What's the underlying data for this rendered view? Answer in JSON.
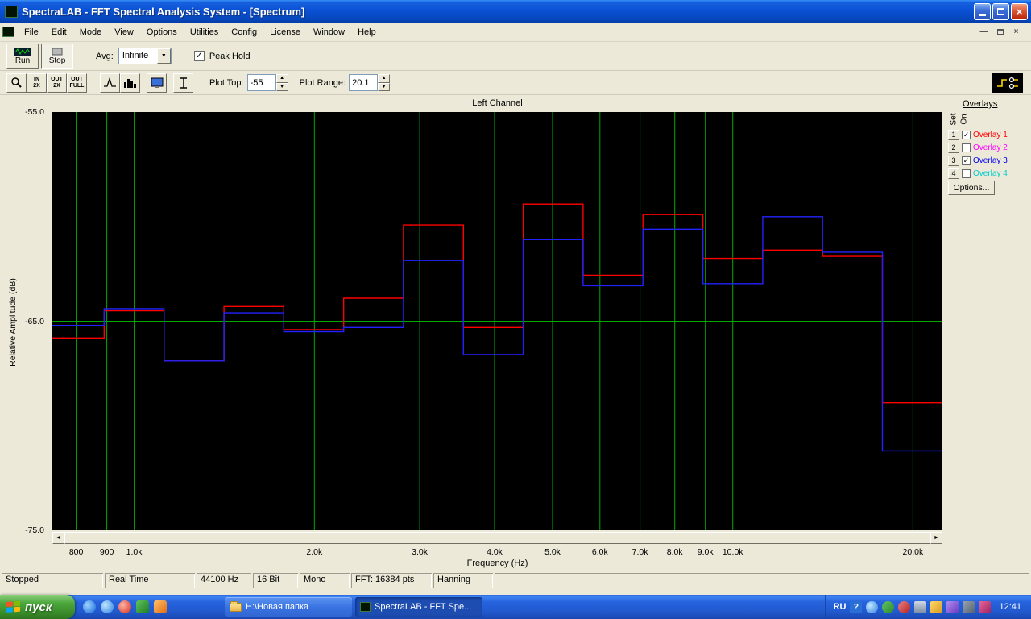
{
  "window": {
    "title": "SpectraLAB - FFT Spectral Analysis System - [Spectrum]"
  },
  "menu": {
    "items": [
      "File",
      "Edit",
      "Mode",
      "View",
      "Options",
      "Utilities",
      "Config",
      "License",
      "Window",
      "Help"
    ]
  },
  "toolbar": {
    "run_label": "Run",
    "stop_label": "Stop",
    "avg_label": "Avg:",
    "avg_value": "Infinite",
    "peak_hold_label": "Peak Hold",
    "peak_hold_checked": true,
    "zoom_btns": [
      {
        "line1": "IN",
        "line2": "2X"
      },
      {
        "line1": "OUT",
        "line2": "2X"
      },
      {
        "line1": "OUT",
        "line2": "FULL"
      }
    ],
    "plot_top_label": "Plot Top:",
    "plot_top_value": "-55",
    "plot_range_label": "Plot Range:",
    "plot_range_value": "20.1"
  },
  "chart_data": {
    "type": "line",
    "subtype": "stepped-spectrum",
    "title": "Left Channel",
    "xlabel": "Frequency (Hz)",
    "ylabel": "Relative Amplitude (dB)",
    "x_scale": "log",
    "xlim": [
      730,
      22400
    ],
    "ylim": [
      -75,
      -55
    ],
    "grid_color": "#00AB00",
    "background": "#000000",
    "y_ticks": [
      {
        "v": -55,
        "label": "-55.0"
      },
      {
        "v": -65,
        "label": "-65.0"
      },
      {
        "v": -75,
        "label": "-75.0"
      }
    ],
    "y_gridlines": [
      -65
    ],
    "x_gridlines": [
      800,
      900,
      1000,
      2000,
      3000,
      4000,
      5000,
      6000,
      7000,
      8000,
      9000,
      10000,
      20000
    ],
    "x_ticks": [
      {
        "f": 800,
        "label": "800"
      },
      {
        "f": 900,
        "label": "900"
      },
      {
        "f": 1000,
        "label": "1.0k"
      },
      {
        "f": 2000,
        "label": "2.0k"
      },
      {
        "f": 3000,
        "label": "3.0k"
      },
      {
        "f": 4000,
        "label": "4.0k"
      },
      {
        "f": 5000,
        "label": "5.0k"
      },
      {
        "f": 6000,
        "label": "6.0k"
      },
      {
        "f": 7000,
        "label": "7.0k"
      },
      {
        "f": 8000,
        "label": "8.0k"
      },
      {
        "f": 9000,
        "label": "9.0k"
      },
      {
        "f": 10000,
        "label": "10.0k"
      },
      {
        "f": 20000,
        "label": "20.0k"
      }
    ],
    "band_edges": [
      730,
      891,
      1122,
      1413,
      1778,
      2239,
      2818,
      3548,
      4467,
      5623,
      7079,
      8913,
      11220,
      14125,
      17783,
      22387
    ],
    "series": [
      {
        "name": "Overlay 1",
        "color": "#FF0000",
        "values": [
          -65.8,
          -64.5,
          -66.9,
          -64.3,
          -65.4,
          -63.9,
          -60.4,
          -65.3,
          -59.4,
          -62.8,
          -59.9,
          -62.0,
          -61.6,
          -61.9,
          -68.9
        ]
      },
      {
        "name": "Overlay 3",
        "color": "#2222FF",
        "values": [
          -65.2,
          -64.4,
          -66.9,
          -64.6,
          -65.5,
          -65.3,
          -62.1,
          -66.6,
          -61.1,
          -63.3,
          -60.6,
          -63.2,
          -60.0,
          -61.7,
          -71.2
        ]
      }
    ]
  },
  "overlays": {
    "title": "Overlays",
    "col_set": "Set",
    "col_on": "On",
    "rows": [
      {
        "num": "1",
        "label": "Overlay 1",
        "color": "#FF0000",
        "checked": true
      },
      {
        "num": "2",
        "label": "Overlay 2",
        "color": "#FF00FF",
        "checked": false
      },
      {
        "num": "3",
        "label": "Overlay 3",
        "color": "#0000EE",
        "checked": true
      },
      {
        "num": "4",
        "label": "Overlay 4",
        "color": "#00CCCC",
        "checked": false
      }
    ],
    "options_label": "Options..."
  },
  "status": {
    "cells": [
      "Stopped",
      "Real Time",
      "44100 Hz",
      "16 Bit",
      "Mono",
      "FFT: 16384 pts",
      "Hanning"
    ]
  },
  "taskbar": {
    "start_label": "пуск",
    "tasks": [
      {
        "label": "H:\\Новая папка",
        "active": false
      },
      {
        "label": "SpectraLAB - FFT Spe...",
        "active": true
      }
    ],
    "tray": {
      "lang": "RU",
      "clock": "12:41"
    }
  },
  "icons": {
    "check": "✓",
    "dropdown_arrow": "▼",
    "spin_up": "▲",
    "spin_down": "▼",
    "scroll_left": "◄",
    "scroll_right": "►",
    "close": "×",
    "minimize": "—",
    "help": "?"
  }
}
